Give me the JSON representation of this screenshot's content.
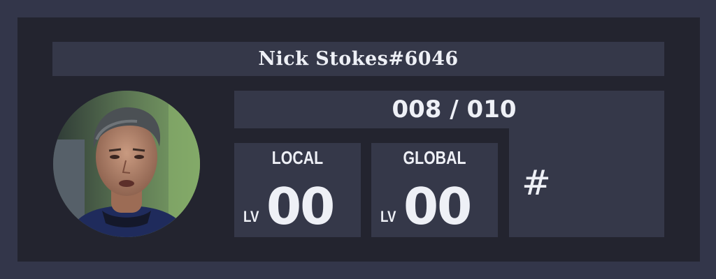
{
  "profile": {
    "username": "Nick Stokes#6046",
    "avatar_icon": "user-avatar-photo"
  },
  "experience": {
    "text": "008 / 010",
    "current": 8,
    "max": 10
  },
  "levels": {
    "local": {
      "title": "LOCAL",
      "prefix": "LV",
      "value": "00"
    },
    "global": {
      "title": "GLOBAL",
      "prefix": "LV",
      "value": "00"
    }
  },
  "rank": {
    "text": "#"
  },
  "colors": {
    "background": "#33364a",
    "card": "#23242f",
    "panel": "#353849",
    "text": "#eef0f6"
  }
}
